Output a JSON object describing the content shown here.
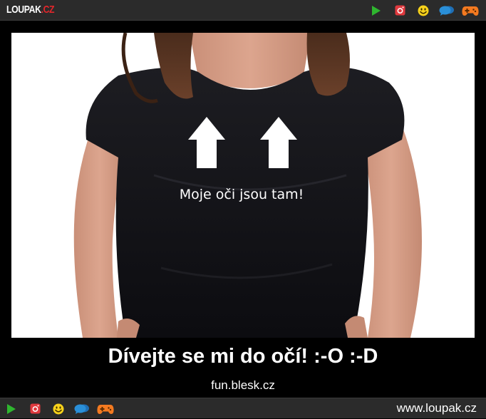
{
  "header": {
    "logo_main": "LOUPAK",
    "logo_tld": ".CZ",
    "icons": [
      "play-icon",
      "instagram-icon",
      "smiley-icon",
      "chat-icon",
      "gamepad-icon"
    ]
  },
  "main": {
    "shirt_text": "Moje oči jsou tam!",
    "caption": "Dívejte se mi do očí! :-O :-D",
    "source": "fun.blesk.cz"
  },
  "footer": {
    "site": "www.loupak.cz",
    "icons": [
      "play-icon",
      "instagram-icon",
      "smiley-icon",
      "chat-icon",
      "gamepad-icon"
    ]
  },
  "colors": {
    "bar_background": "#2b2b2b",
    "logo_accent": "#e3262b",
    "play_green": "#2fb62f",
    "instagram_red": "#e0393e",
    "smiley_yellow": "#f7d21b",
    "chat_blue": "#2a8fd8",
    "gamepad_orange": "#f47a20"
  }
}
